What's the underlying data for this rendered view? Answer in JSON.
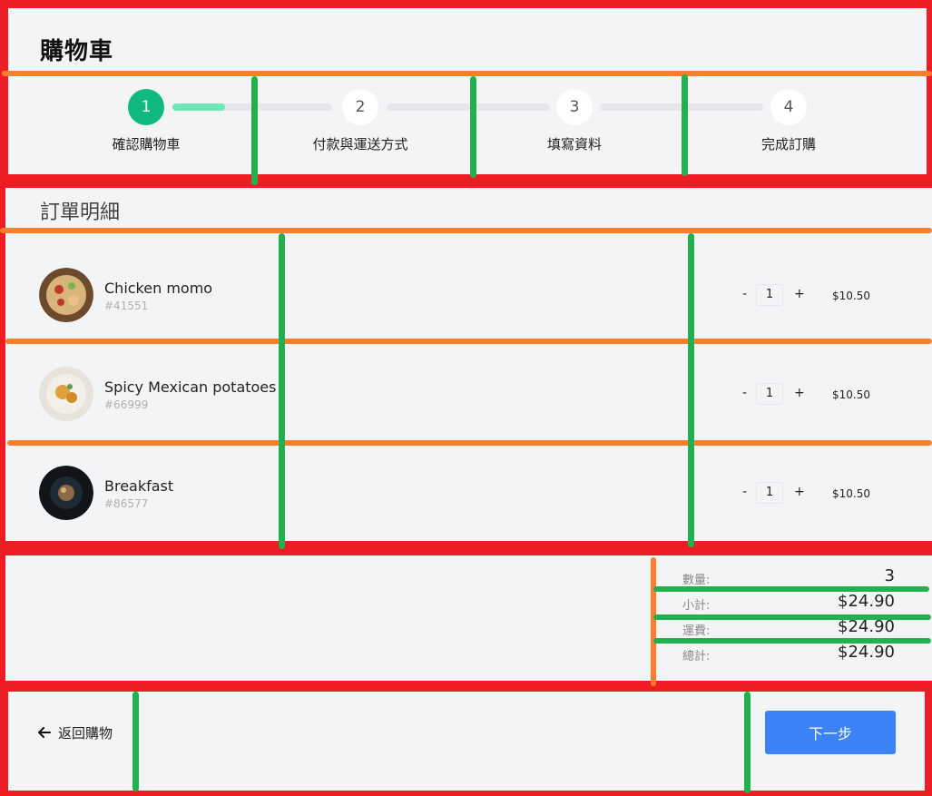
{
  "header": {
    "title": "購物車"
  },
  "steps": [
    {
      "number": "1",
      "label": "確認購物車"
    },
    {
      "number": "2",
      "label": "付款與運送方式"
    },
    {
      "number": "3",
      "label": "填寫資料"
    },
    {
      "number": "4",
      "label": "完成訂購"
    }
  ],
  "order": {
    "title": "訂單明細",
    "items": [
      {
        "name": "Chicken momo",
        "id": "#41551",
        "minus": "-",
        "quantity": "1",
        "plus": "+",
        "price": "$10.50"
      },
      {
        "name": "Spicy Mexican potatoes",
        "id": "#66999",
        "minus": "-",
        "quantity": "1",
        "plus": "+",
        "price": "$10.50"
      },
      {
        "name": "Breakfast",
        "id": "#86577",
        "minus": "-",
        "quantity": "1",
        "plus": "+",
        "price": "$10.50"
      }
    ]
  },
  "summary": {
    "quantity_label": "數量:",
    "quantity_value": "3",
    "subtotal_label": "小計:",
    "subtotal_value": "$24.90",
    "shipping_label": "運費:",
    "shipping_value": "$24.90",
    "total_label": "總計:",
    "total_value": "$24.90"
  },
  "footer": {
    "back_label": "返回購物",
    "next_label": "下一步"
  },
  "colors": {
    "accent": "#10b981",
    "primary_button": "#3b82f6",
    "annotation_red": "#ee1c25",
    "annotation_orange": "#fb7e2c",
    "annotation_green": "#22b14c"
  }
}
